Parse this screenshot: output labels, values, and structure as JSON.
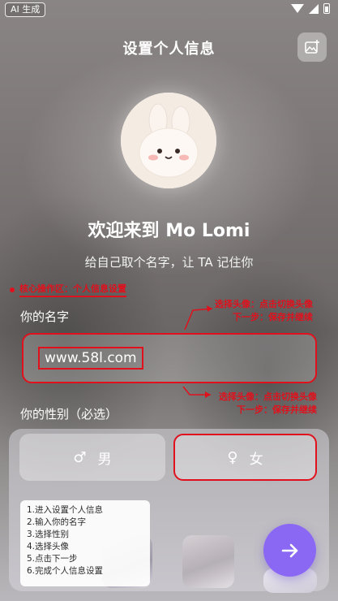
{
  "status_bar": {
    "ai_badge": "AI 生成"
  },
  "header": {
    "title": "设置个人信息"
  },
  "welcome": {
    "title": "欢迎来到 Mo Lomi",
    "subtitle": "给自己取个名字，让 TA 记住你"
  },
  "annotation": {
    "title": "核心操作区：个人信息设置",
    "callout_line1": "选择头像：点击切换头像",
    "callout_line2": "下一步：保存并继续"
  },
  "name_section": {
    "label": "你的名字",
    "value": "www.58l.com"
  },
  "gender_section": {
    "label": "你的性别（必选）",
    "male": {
      "symbol": "♂",
      "label": "男"
    },
    "female": {
      "symbol": "♀",
      "label": "女"
    }
  },
  "steps": [
    "1.进入设置个人信息",
    "2.输入你的名字",
    "3.选择性别",
    "4.选择头像",
    "5.点击下一步",
    "6.完成个人信息设置"
  ],
  "colors": {
    "annotation_red": "#e0111d",
    "next_button": "#8a68f4"
  },
  "icons": {
    "gallery": "image-add-icon",
    "next": "arrow-right-icon",
    "wifi": "wifi-icon",
    "signal": "signal-icon",
    "battery": "battery-icon"
  }
}
